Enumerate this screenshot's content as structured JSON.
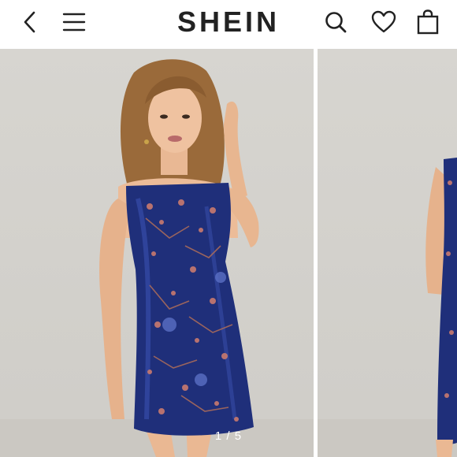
{
  "header": {
    "brand": "SHEIN",
    "icons": {
      "back": "chevron-left-icon",
      "menu": "hamburger-menu-icon",
      "search": "search-icon",
      "wishlist": "heart-icon",
      "bag": "shopping-bag-icon"
    }
  },
  "gallery": {
    "counter": "1 / 5",
    "current_image": 1,
    "total_images": 5
  },
  "colors": {
    "background": "#d7d5d0",
    "dress": "#1f2f7a",
    "text": "#222222"
  }
}
